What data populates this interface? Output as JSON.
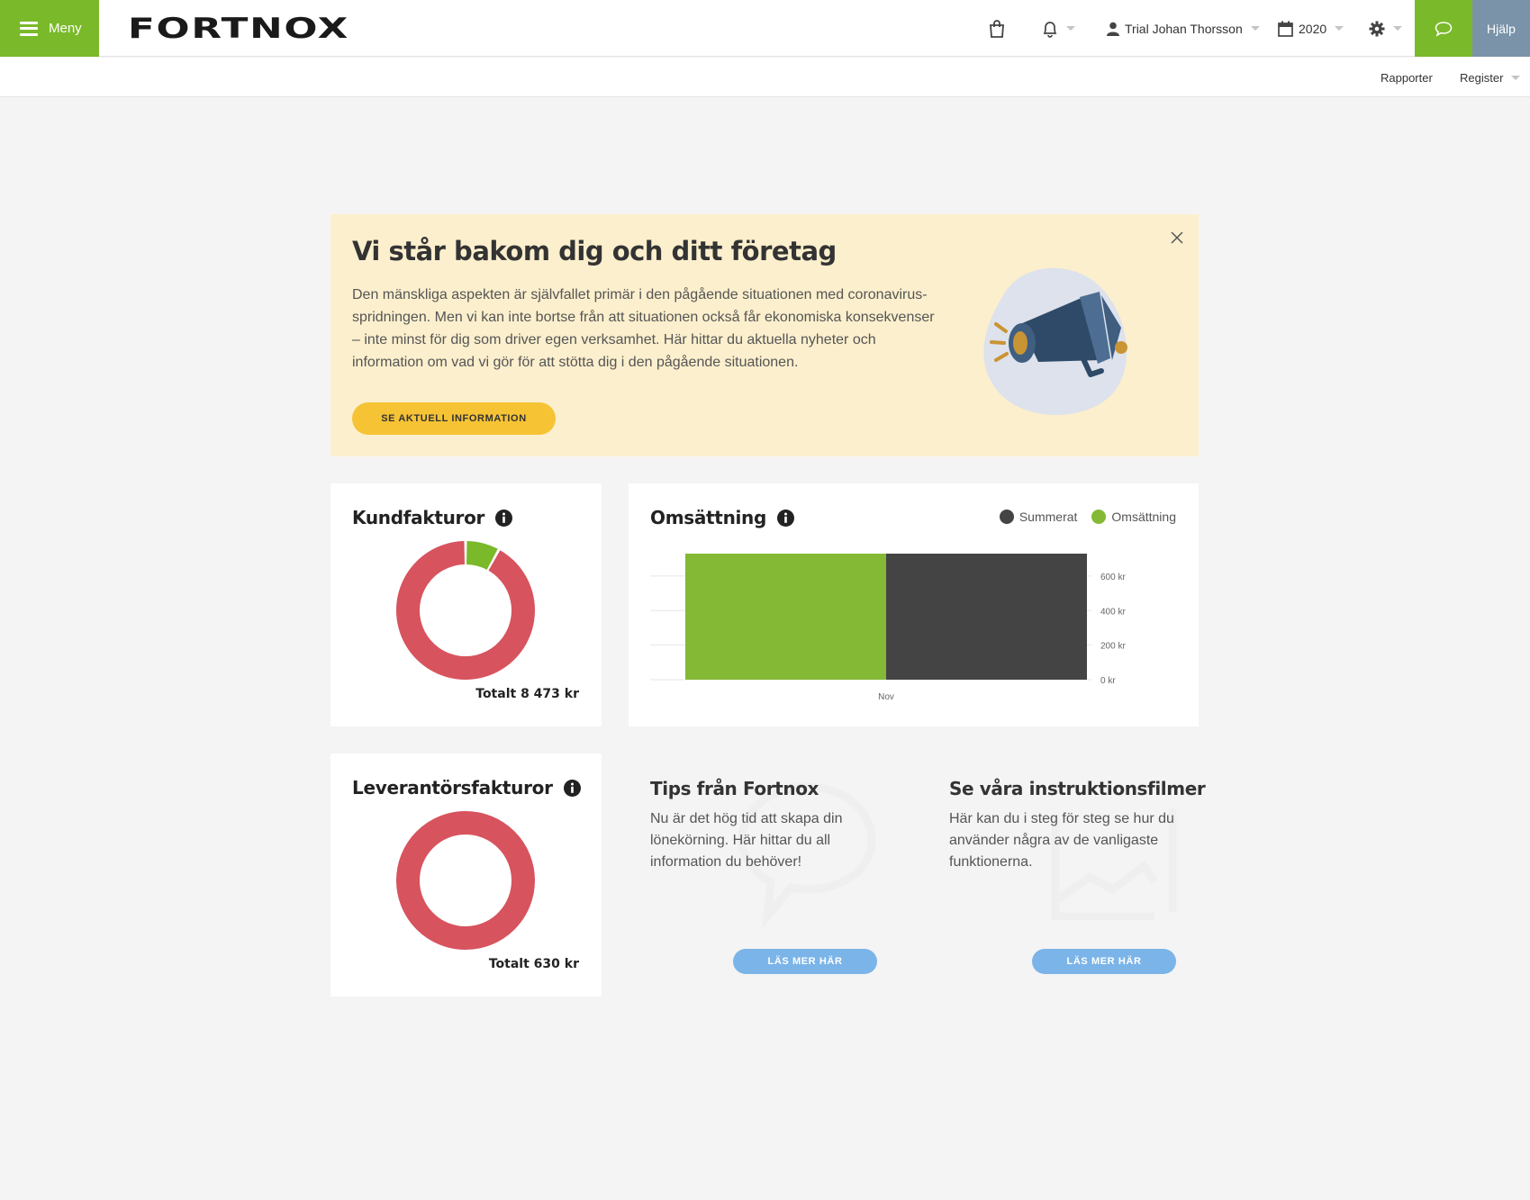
{
  "topbar": {
    "menu_label": "Meny",
    "logo_text": "FORTNOX",
    "user_name": "Trial Johan Thorsson",
    "year": "2020",
    "help_label": "Hjälp"
  },
  "subbar": {
    "reports_label": "Rapporter",
    "register_label": "Register"
  },
  "banner": {
    "title": "Vi står bakom dig och ditt företag",
    "text": "Den mänskliga aspekten är självfallet primär i den pågående situationen med coronavirus-spridningen. Men vi kan inte bortse från att situationen också får ekonomiska konsekvenser – inte minst för dig som driver egen verksamhet. Här hittar du aktuella nyheter och information om vad vi gör för att stötta dig i den pågående situationen.",
    "button_label": "SE AKTUELL INFORMATION"
  },
  "kundfakturor": {
    "title": "Kundfakturor",
    "total": "Totalt 8 473 kr"
  },
  "omsattning": {
    "title": "Omsättning",
    "legend": [
      {
        "label": "Summerat",
        "color": "#444444"
      },
      {
        "label": "Omsättning",
        "color": "#84b935"
      }
    ]
  },
  "leverantorsfakturor": {
    "title": "Leverantörsfakturor",
    "total": "Totalt 630 kr"
  },
  "tips": {
    "title": "Tips från Fortnox",
    "text": "Nu är det hög tid att skapa din lönekörning. Här hittar du all information du behöver!",
    "button_label": "LÄS MER HÄR"
  },
  "films": {
    "title": "Se våra instruktionsfilmer",
    "text": "Här kan du i steg för steg se hur du använder några av de vanligaste funktionerna.",
    "button_label": "LÄS MER HÄR"
  },
  "colors": {
    "brand_green": "#7ab929",
    "overdue_red": "#d7535e",
    "paid_green": "#7ab929",
    "dark_series": "#444444",
    "banner_bg": "#fcefcd",
    "banner_button": "#f6c335",
    "info_button": "#7bb4e8"
  },
  "chart_data": [
    {
      "type": "pie",
      "name": "Kundfakturor",
      "slices": [
        {
          "label": "",
          "value": 0.92,
          "color": "#d7535e"
        },
        {
          "label": "",
          "value": 0.08,
          "color": "#7ab929"
        }
      ],
      "donut": true
    },
    {
      "type": "bar",
      "name": "Omsättning",
      "categories": [
        "Nov"
      ],
      "series": [
        {
          "name": "Omsättning",
          "values": [
            730
          ],
          "color": "#84b935"
        },
        {
          "name": "Summerat",
          "values": [
            730
          ],
          "color": "#444444"
        }
      ],
      "y_ticks": [
        "0 kr",
        "200 kr",
        "400 kr",
        "600 kr"
      ],
      "ylim": [
        0,
        730
      ],
      "legend": "top-right",
      "grid": true
    },
    {
      "type": "pie",
      "name": "Leverantörsfakturor",
      "slices": [
        {
          "label": "",
          "value": 1.0,
          "color": "#d7535e"
        }
      ],
      "donut": true
    }
  ]
}
